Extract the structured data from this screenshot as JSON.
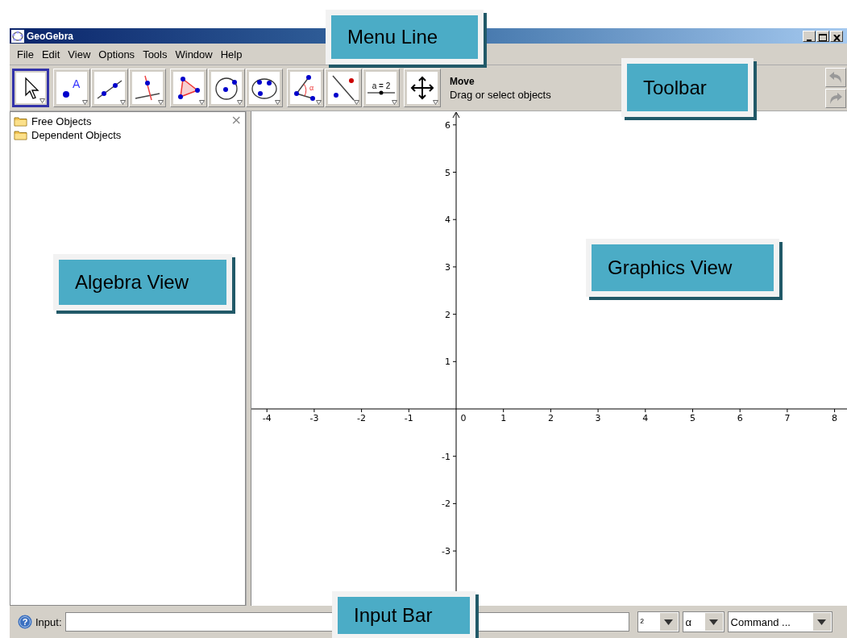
{
  "window": {
    "title": "GeoGebra"
  },
  "menu": [
    "File",
    "Edit",
    "View",
    "Options",
    "Tools",
    "Window",
    "Help"
  ],
  "toolbar": {
    "groups": [
      [
        {
          "selected": true
        }
      ],
      [
        {
          "selected": false,
          "icon_text": "A"
        },
        {
          "selected": false
        },
        {
          "selected": false
        }
      ],
      [
        {
          "selected": false
        },
        {
          "selected": false
        },
        {
          "selected": false
        }
      ],
      [
        {
          "selected": false,
          "icon_text": "α"
        },
        {
          "selected": false
        },
        {
          "selected": false,
          "label": "a = 2"
        }
      ],
      [
        {
          "selected": false
        }
      ]
    ],
    "help_title": "Move",
    "help_text": "Drag or select objects"
  },
  "algebra_view": {
    "items": [
      {
        "label": "Free Objects"
      },
      {
        "label": "Dependent Objects"
      }
    ],
    "close": "×"
  },
  "graphics_view": {
    "x_ticks": [
      "-4",
      "-3",
      "-2",
      "-1",
      "0",
      "1",
      "2",
      "3",
      "4",
      "5",
      "6",
      "7",
      "8"
    ],
    "y_ticks": [
      "6",
      "5",
      "4",
      "3",
      "2",
      "1",
      "-1",
      "-2",
      "-3"
    ]
  },
  "input_bar": {
    "help": "?",
    "label": "Input:",
    "dropdowns": [
      "²",
      "α",
      "Command ..."
    ]
  },
  "callouts": [
    "Menu Line",
    "Toolbar",
    "Algebra View",
    "Graphics View",
    "Input Bar"
  ]
}
